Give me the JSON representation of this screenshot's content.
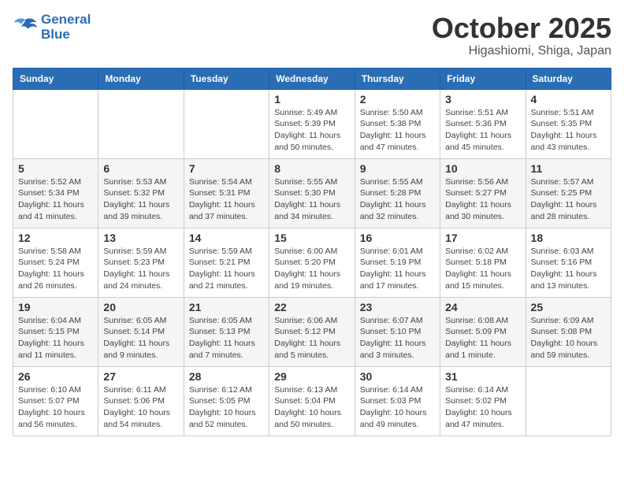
{
  "header": {
    "logo_line1": "General",
    "logo_line2": "Blue",
    "month": "October 2025",
    "location": "Higashiomi, Shiga, Japan"
  },
  "weekdays": [
    "Sunday",
    "Monday",
    "Tuesday",
    "Wednesday",
    "Thursday",
    "Friday",
    "Saturday"
  ],
  "weeks": [
    [
      {
        "day": "",
        "info": ""
      },
      {
        "day": "",
        "info": ""
      },
      {
        "day": "",
        "info": ""
      },
      {
        "day": "1",
        "info": "Sunrise: 5:49 AM\nSunset: 5:39 PM\nDaylight: 11 hours\nand 50 minutes."
      },
      {
        "day": "2",
        "info": "Sunrise: 5:50 AM\nSunset: 5:38 PM\nDaylight: 11 hours\nand 47 minutes."
      },
      {
        "day": "3",
        "info": "Sunrise: 5:51 AM\nSunset: 5:36 PM\nDaylight: 11 hours\nand 45 minutes."
      },
      {
        "day": "4",
        "info": "Sunrise: 5:51 AM\nSunset: 5:35 PM\nDaylight: 11 hours\nand 43 minutes."
      }
    ],
    [
      {
        "day": "5",
        "info": "Sunrise: 5:52 AM\nSunset: 5:34 PM\nDaylight: 11 hours\nand 41 minutes."
      },
      {
        "day": "6",
        "info": "Sunrise: 5:53 AM\nSunset: 5:32 PM\nDaylight: 11 hours\nand 39 minutes."
      },
      {
        "day": "7",
        "info": "Sunrise: 5:54 AM\nSunset: 5:31 PM\nDaylight: 11 hours\nand 37 minutes."
      },
      {
        "day": "8",
        "info": "Sunrise: 5:55 AM\nSunset: 5:30 PM\nDaylight: 11 hours\nand 34 minutes."
      },
      {
        "day": "9",
        "info": "Sunrise: 5:55 AM\nSunset: 5:28 PM\nDaylight: 11 hours\nand 32 minutes."
      },
      {
        "day": "10",
        "info": "Sunrise: 5:56 AM\nSunset: 5:27 PM\nDaylight: 11 hours\nand 30 minutes."
      },
      {
        "day": "11",
        "info": "Sunrise: 5:57 AM\nSunset: 5:25 PM\nDaylight: 11 hours\nand 28 minutes."
      }
    ],
    [
      {
        "day": "12",
        "info": "Sunrise: 5:58 AM\nSunset: 5:24 PM\nDaylight: 11 hours\nand 26 minutes."
      },
      {
        "day": "13",
        "info": "Sunrise: 5:59 AM\nSunset: 5:23 PM\nDaylight: 11 hours\nand 24 minutes."
      },
      {
        "day": "14",
        "info": "Sunrise: 5:59 AM\nSunset: 5:21 PM\nDaylight: 11 hours\nand 21 minutes."
      },
      {
        "day": "15",
        "info": "Sunrise: 6:00 AM\nSunset: 5:20 PM\nDaylight: 11 hours\nand 19 minutes."
      },
      {
        "day": "16",
        "info": "Sunrise: 6:01 AM\nSunset: 5:19 PM\nDaylight: 11 hours\nand 17 minutes."
      },
      {
        "day": "17",
        "info": "Sunrise: 6:02 AM\nSunset: 5:18 PM\nDaylight: 11 hours\nand 15 minutes."
      },
      {
        "day": "18",
        "info": "Sunrise: 6:03 AM\nSunset: 5:16 PM\nDaylight: 11 hours\nand 13 minutes."
      }
    ],
    [
      {
        "day": "19",
        "info": "Sunrise: 6:04 AM\nSunset: 5:15 PM\nDaylight: 11 hours\nand 11 minutes."
      },
      {
        "day": "20",
        "info": "Sunrise: 6:05 AM\nSunset: 5:14 PM\nDaylight: 11 hours\nand 9 minutes."
      },
      {
        "day": "21",
        "info": "Sunrise: 6:05 AM\nSunset: 5:13 PM\nDaylight: 11 hours\nand 7 minutes."
      },
      {
        "day": "22",
        "info": "Sunrise: 6:06 AM\nSunset: 5:12 PM\nDaylight: 11 hours\nand 5 minutes."
      },
      {
        "day": "23",
        "info": "Sunrise: 6:07 AM\nSunset: 5:10 PM\nDaylight: 11 hours\nand 3 minutes."
      },
      {
        "day": "24",
        "info": "Sunrise: 6:08 AM\nSunset: 5:09 PM\nDaylight: 11 hours\nand 1 minute."
      },
      {
        "day": "25",
        "info": "Sunrise: 6:09 AM\nSunset: 5:08 PM\nDaylight: 10 hours\nand 59 minutes."
      }
    ],
    [
      {
        "day": "26",
        "info": "Sunrise: 6:10 AM\nSunset: 5:07 PM\nDaylight: 10 hours\nand 56 minutes."
      },
      {
        "day": "27",
        "info": "Sunrise: 6:11 AM\nSunset: 5:06 PM\nDaylight: 10 hours\nand 54 minutes."
      },
      {
        "day": "28",
        "info": "Sunrise: 6:12 AM\nSunset: 5:05 PM\nDaylight: 10 hours\nand 52 minutes."
      },
      {
        "day": "29",
        "info": "Sunrise: 6:13 AM\nSunset: 5:04 PM\nDaylight: 10 hours\nand 50 minutes."
      },
      {
        "day": "30",
        "info": "Sunrise: 6:14 AM\nSunset: 5:03 PM\nDaylight: 10 hours\nand 49 minutes."
      },
      {
        "day": "31",
        "info": "Sunrise: 6:14 AM\nSunset: 5:02 PM\nDaylight: 10 hours\nand 47 minutes."
      },
      {
        "day": "",
        "info": ""
      }
    ]
  ]
}
